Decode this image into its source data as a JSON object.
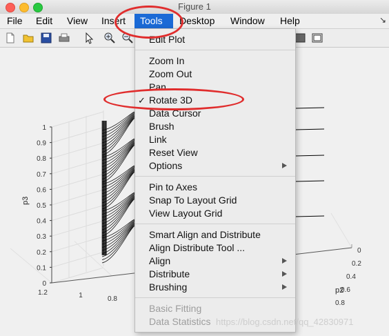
{
  "window": {
    "title": "Figure 1"
  },
  "menubar": {
    "items": [
      "File",
      "Edit",
      "View",
      "Insert",
      "Tools",
      "Desktop",
      "Window",
      "Help"
    ],
    "active": "Tools",
    "corner_glyph": "↘"
  },
  "toolbar": {
    "icons": [
      "new-file-icon",
      "open-folder-icon",
      "save-icon",
      "print-icon",
      "pointer-icon",
      "zoom-in-icon",
      "zoom-out-icon"
    ]
  },
  "tools_menu": {
    "groups": [
      [
        {
          "label": "Edit Plot"
        }
      ],
      [
        {
          "label": "Zoom In"
        },
        {
          "label": "Zoom Out"
        },
        {
          "label": "Pan"
        },
        {
          "label": "Rotate 3D",
          "checked": true
        },
        {
          "label": "Data Cursor"
        },
        {
          "label": "Brush"
        },
        {
          "label": "Link"
        },
        {
          "label": "Reset View"
        },
        {
          "label": "Options",
          "submenu": true
        }
      ],
      [
        {
          "label": "Pin to Axes"
        },
        {
          "label": "Snap To Layout Grid"
        },
        {
          "label": "View Layout Grid"
        }
      ],
      [
        {
          "label": "Smart Align and Distribute"
        },
        {
          "label": "Align Distribute Tool ..."
        },
        {
          "label": "Align",
          "submenu": true
        },
        {
          "label": "Distribute",
          "submenu": true
        },
        {
          "label": "Brushing",
          "submenu": true
        }
      ],
      [
        {
          "label": "Basic Fitting",
          "disabled": true
        },
        {
          "label": "Data Statistics",
          "disabled": true
        }
      ]
    ],
    "check_glyph": "✓"
  },
  "plot": {
    "zlabel": "p3",
    "ylabel": "p2",
    "z_ticks": [
      "0",
      "0.1",
      "0.2",
      "0.3",
      "0.4",
      "0.5",
      "0.6",
      "0.7",
      "0.8",
      "0.9",
      "1"
    ],
    "x_ticks": [
      "1.2",
      "1",
      "0.8"
    ],
    "y_ticks": [
      "0",
      "0.2",
      "0.4",
      "0.6",
      "0.8"
    ],
    "line_color": "#000000"
  },
  "annotations": {
    "color": "#e02d2d"
  },
  "watermark": "https://blog.csdn.net/qq_42830971"
}
